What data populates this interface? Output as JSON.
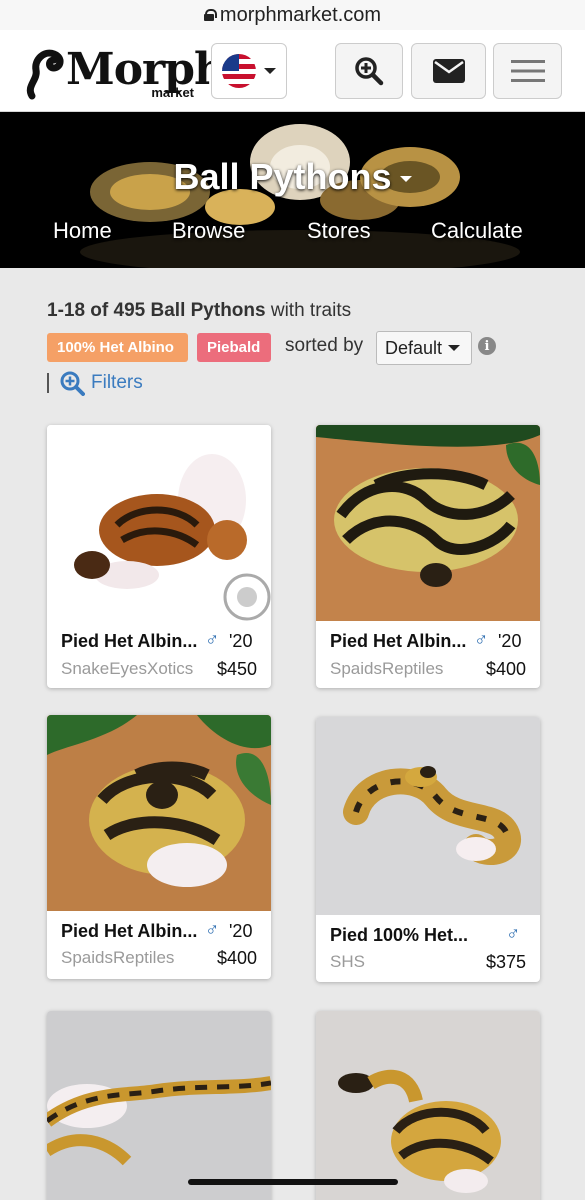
{
  "browser": {
    "url": "morphmarket.com"
  },
  "header": {
    "logo_text": "Morph",
    "logo_sub": "market",
    "flag_icon": "us-flag-icon",
    "search_icon": "zoom-search-icon",
    "mail_icon": "envelope-icon",
    "menu_icon": "hamburger-menu-icon"
  },
  "hero": {
    "title": "Ball Pythons",
    "nav": [
      "Home",
      "Browse",
      "Stores",
      "Calculate"
    ]
  },
  "results": {
    "count_text": "1-18 of 495 Ball Pythons",
    "suffix": " with traits",
    "tags": [
      "100% Het Albino",
      "Piebald"
    ],
    "sorted_by_label": "sorted by",
    "sort_value": "Default",
    "info_glyph": "i",
    "filters_label": "Filters"
  },
  "listings": [
    {
      "title": "Pied Het Albin...",
      "sex": "♂",
      "year": "'20",
      "store": "SnakeEyesXotics",
      "price": "$450"
    },
    {
      "title": "Pied Het Albin...",
      "sex": "♂",
      "year": "'20",
      "store": "SpaidsReptiles",
      "price": "$400"
    },
    {
      "title": "Pied Het Albin...",
      "sex": "♂",
      "year": "'20",
      "store": "SpaidsReptiles",
      "price": "$400"
    },
    {
      "title": "Pied 100% Het...",
      "sex": "♂",
      "year": "",
      "store": "SHS",
      "price": "$375"
    },
    {
      "title": "",
      "sex": "",
      "year": "",
      "store": "",
      "price": ""
    },
    {
      "title": "",
      "sex": "",
      "year": "",
      "store": "",
      "price": ""
    }
  ],
  "colors": {
    "tag_albino": "#f5a066",
    "tag_pied": "#ec6d7c",
    "link": "#3a7bbf",
    "male": "#2b6cb0",
    "hero_bg": "#000000"
  }
}
